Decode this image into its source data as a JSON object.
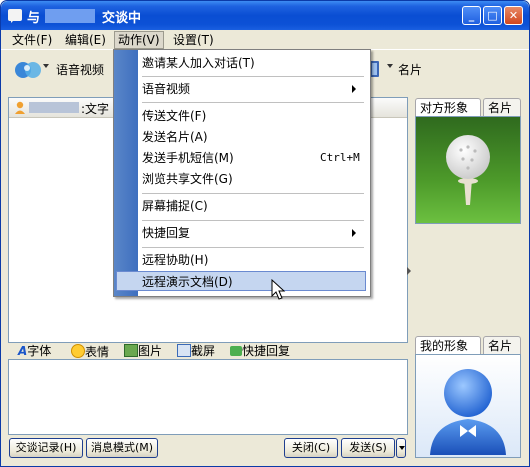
{
  "window": {
    "title_prefix": "与",
    "title_suffix": "交谈中",
    "buttons": {
      "minimize": "_",
      "maximize": "□",
      "close": "✕"
    }
  },
  "menubar": [
    {
      "label": "文件(F)"
    },
    {
      "label": "编辑(E)"
    },
    {
      "label": "动作(V)"
    },
    {
      "label": "设置(T)"
    }
  ],
  "toolbar": {
    "voice_video": "语音视频",
    "card": "名片"
  },
  "chat": {
    "header_label": ":文字"
  },
  "format_bar": [
    {
      "label": "字体",
      "icon": "font-icon"
    },
    {
      "label": "表情",
      "icon": "smiley-icon"
    },
    {
      "label": "图片",
      "icon": "picture-icon"
    },
    {
      "label": "截屏",
      "icon": "screenshot-icon"
    },
    {
      "label": "快捷回复",
      "icon": "quick-reply-icon"
    }
  ],
  "bottom_buttons": {
    "history": "交谈记录(H)",
    "message_mode": "消息模式(M)",
    "close": "关闭(C)",
    "send": "发送(S)"
  },
  "right_panel": {
    "peer_tab": "对方形象",
    "peer_card_tab": "名片",
    "my_tab": "我的形象",
    "my_card_tab": "名片"
  },
  "action_menu": {
    "items": [
      {
        "label": "邀请某人加入对话(T)"
      },
      {
        "label": "语音视频",
        "submenu": true
      },
      {
        "label": "传送文件(F)"
      },
      {
        "label": "发送名片(A)"
      },
      {
        "label": "发送手机短信(M)",
        "accel": "Ctrl+M"
      },
      {
        "label": "浏览共享文件(G)"
      },
      {
        "label": "屏幕捕捉(C)"
      },
      {
        "label": "快捷回复",
        "submenu": true
      },
      {
        "label": "远程协助(H)"
      },
      {
        "label": "远程演示文档(D)",
        "highlighted": true
      }
    ]
  },
  "colors": {
    "titlebar": "#0a4ed3",
    "menu_highlight": "#c5d6f0",
    "menu_strip": "#3e6fbf"
  }
}
